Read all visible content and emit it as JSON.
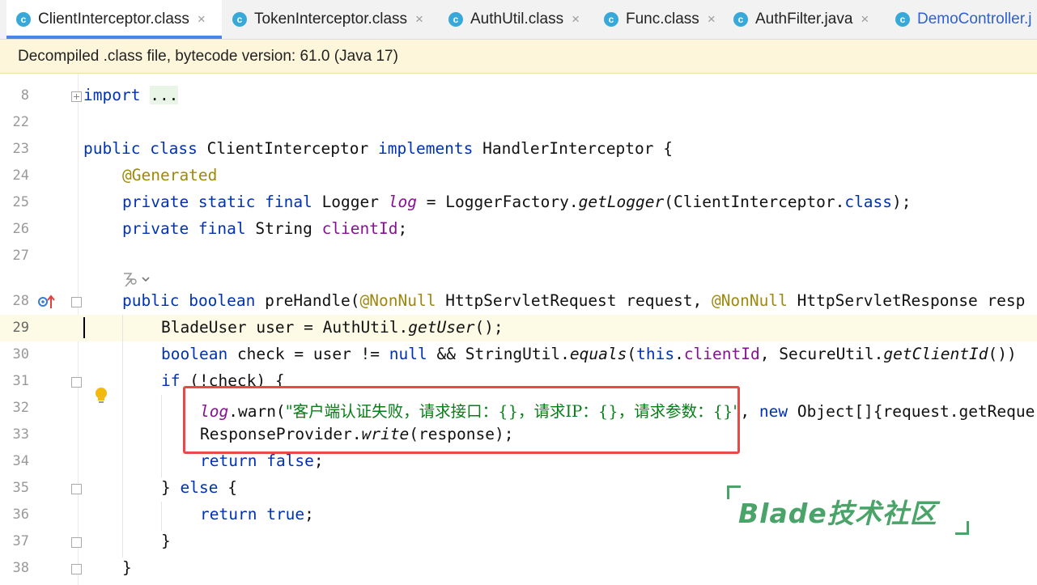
{
  "tabs": [
    {
      "label": "ClientInterceptor.class",
      "icon": "class-icon",
      "active": true
    },
    {
      "label": "TokenInterceptor.class",
      "icon": "class-icon"
    },
    {
      "label": "AuthUtil.class",
      "icon": "class-icon"
    },
    {
      "label": "Func.class",
      "icon": "class-icon"
    },
    {
      "label": "AuthFilter.java",
      "icon": "class-icon"
    },
    {
      "label": "DemoController.j",
      "icon": "class-icon"
    }
  ],
  "tab_icon_letter": "c",
  "tab_close": "×",
  "banner": {
    "text": "Decompiled .class file, bytecode version: 61.0 (Java 17)"
  },
  "line_numbers": [
    "8",
    "22",
    "23",
    "24",
    "25",
    "26",
    "27",
    "28",
    "29",
    "30",
    "31",
    "32",
    "33",
    "34",
    "35",
    "36",
    "37",
    "38"
  ],
  "code": {
    "l8_import": "import",
    "l8_dots": "...",
    "l23_public": "public",
    "l23_class": "class",
    "l23_name": "ClientInterceptor",
    "l23_implements": "implements",
    "l23_iface": "HandlerInterceptor {",
    "l24_annotation": "@Generated",
    "l25_mods": "private static final",
    "l25_type": "Logger",
    "l25_field": "log",
    "l25_eq": "= LoggerFactory.",
    "l25_method": "getLogger",
    "l25_arg": "(ClientInterceptor.",
    "l25_class": "class",
    "l25_end": ");",
    "l26_mods": "private final",
    "l26_type": "String",
    "l26_field": "clientId",
    "l26_end": ";",
    "l28_public": "public",
    "l28_boolean": "boolean",
    "l28_method": "preHandle(",
    "l28_ann1": "@NonNull",
    "l28_p1": "HttpServletRequest request,",
    "l28_ann2": "@NonNull",
    "l28_p2": "HttpServletResponse resp",
    "l29_a": "BladeUser user = AuthUtil.",
    "l29_m": "getUser",
    "l29_b": "();",
    "l30_boolean": "boolean",
    "l30_a": "check = user !=",
    "l30_null": "null",
    "l30_b": "&& StringUtil.",
    "l30_equals": "equals",
    "l30_c": "(",
    "l30_this": "this",
    "l30_d": ".",
    "l30_field": "clientId",
    "l30_e": ", SecureUtil.",
    "l30_m": "getClientId",
    "l30_f": "())",
    "l31_if": "if",
    "l31_rest": "(!check) {",
    "l32_log": "log",
    "l32_a": ".warn(",
    "l32_str": "\"客户端认证失败，请求接口：{}，请求IP：{}，请求参数：{}\"",
    "l32_b": ",",
    "l32_new": "new",
    "l32_c": "Object[]{request.getReque",
    "l33_a": "ResponseProvider.",
    "l33_m": "write",
    "l33_b": "(response);",
    "l34_return": "return",
    "l34_false": "false",
    "l34_end": ";",
    "l35_a": "}",
    "l35_else": "else",
    "l35_b": "{",
    "l36_return": "return",
    "l36_true": "true",
    "l36_end": ";",
    "l37": "}",
    "l38": "}"
  },
  "watermark": "Blade技术社区"
}
